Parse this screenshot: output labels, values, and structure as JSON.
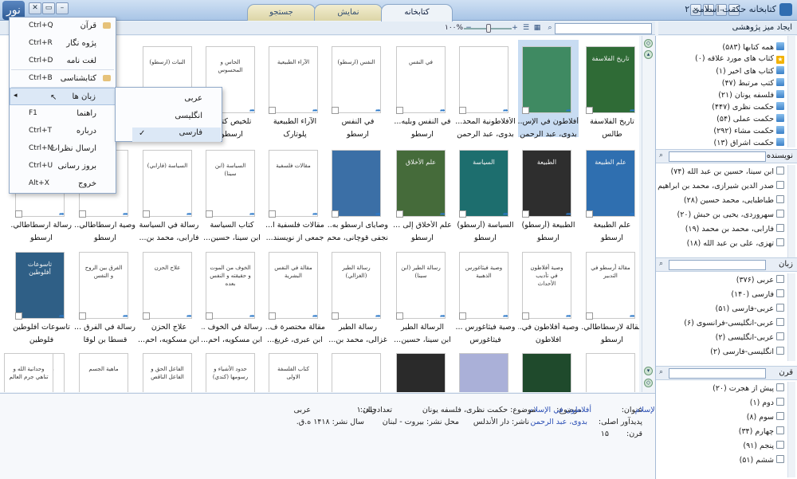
{
  "titlebar": {
    "title": "کتابخانه حکمت اسلامی ۲",
    "logo": "نور"
  },
  "tabs": [
    {
      "label": "جستجو"
    },
    {
      "label": "نمایش"
    },
    {
      "label": "کتابخانه"
    }
  ],
  "toolbar": {
    "zoom": "۱۰۰%",
    "search_placeholder": "",
    "new_table": "ایجاد میز پژوهشی"
  },
  "menu": {
    "items": [
      {
        "label": "قرآن",
        "shortcut": "Ctrl+Q"
      },
      {
        "label": "پژوه نگار",
        "shortcut": "Ctrl+R"
      },
      {
        "label": "لغت نامه",
        "shortcut": "Ctrl+D"
      },
      {
        "label": "کتابشناسی",
        "shortcut": "Ctrl+B"
      },
      {
        "label": "زبان ها",
        "shortcut": ""
      },
      {
        "label": "راهنما",
        "shortcut": "F1"
      },
      {
        "label": "درباره",
        "shortcut": "Ctrl+T"
      },
      {
        "label": "ارسال نظرات",
        "shortcut": "Ctrl+M"
      },
      {
        "label": "بروز رسانی",
        "shortcut": "Ctrl+U"
      },
      {
        "label": "خروج",
        "shortcut": "Alt+X"
      }
    ],
    "languages": [
      {
        "label": "عربی"
      },
      {
        "label": "انگلیسی"
      },
      {
        "label": "فارسی",
        "checked": "✓"
      }
    ]
  },
  "books": [
    {
      "t1": "تاریخ الفلاسفة",
      "t2": "طالس",
      "cover": "تاريخ الفلاسفة",
      "color": "#2f6b36"
    },
    {
      "t1": "أفلاطون في الإس...",
      "t2": "بدوی، عبد الرحمن",
      "cover": "",
      "color": "#3f8a62"
    },
    {
      "t1": "الأفلاطونية المحد...",
      "t2": "بدوی، عبد الرحمن",
      "cover": "",
      "color": "#ffffff"
    },
    {
      "t1": "في النفس وبليه...",
      "t2": "ارسطو",
      "cover": "في النفس",
      "color": "#ffffff"
    },
    {
      "t1": "في النفس",
      "t2": "ارسطو",
      "cover": "النفس (ارسطو)",
      "color": "#ffffff"
    },
    {
      "t1": "الآراء الطبيعية",
      "t2": "پلوتارک",
      "cover": "الآراء الطبيعية",
      "color": "#ffffff"
    },
    {
      "t1": "تلخيص كتا...",
      "t2": "ارسطو",
      "cover": "الحاس و المحسوس",
      "color": "#ffffff"
    },
    {
      "t1": "",
      "t2": "",
      "cover": "النبات (ارسطو)",
      "color": "#ffffff"
    },
    {
      "t1": "علم الطبيعة",
      "t2": "ارسطو",
      "cover": "علم الطبيعة",
      "color": "#2f6fb0"
    },
    {
      "t1": "الطبيعة (أرسطو)",
      "t2": "ارسطو",
      "cover": "الطبيعة",
      "color": "#2e2e2e"
    },
    {
      "t1": "السياسة (أرسطو)",
      "t2": "ارسطو",
      "cover": "السياسة",
      "color": "#1d6e6e"
    },
    {
      "t1": "علم الأخلاق إلى ...",
      "t2": "ارسطو",
      "cover": "علم الأخلاق",
      "color": "#456b3a"
    },
    {
      "t1": "وصايای ارسطو به...",
      "t2": "نجفی قوچانی، محم...",
      "cover": "",
      "color": "#3b6fa6"
    },
    {
      "t1": "مقالات فلسفية ا...",
      "t2": "جمعی از نویسند...",
      "cover": "مقالات فلسفية",
      "color": "#ffffff"
    },
    {
      "t1": "كتاب السياسة",
      "t2": "ابن سینا، حسین...",
      "cover": "السياسة (ابن سينا)",
      "color": "#ffffff"
    },
    {
      "t1": "رسالة في السياسة",
      "t2": "فارابی، محمد بن...",
      "cover": "السياسة (فارابي)",
      "color": "#ffffff"
    },
    {
      "t1": "وصية ارسطاطالي...",
      "t2": "ارسطو",
      "cover": "",
      "color": "#ffffff"
    },
    {
      "t1": "رسالة ارسطاطالي...",
      "t2": "ارسطو",
      "cover": "",
      "color": "#ffffff"
    },
    {
      "t1": "مقالة لارسطاطالي...",
      "t2": "ارسطو",
      "cover": "مقالة أرسطو في التدبير",
      "color": "#ffffff"
    },
    {
      "t1": "وصية أفلاطون في...",
      "t2": "افلاطون",
      "cover": "وصية أفلاطون في تأديب الأحداث",
      "color": "#ffffff"
    },
    {
      "t1": "وصية فيثاغورس ...",
      "t2": "فیثاغورس",
      "cover": "وصية فيثاغورس الذهبية",
      "color": "#ffffff"
    },
    {
      "t1": "الرسالة الطير",
      "t2": "ابن سینا، حسین...",
      "cover": "رسالة الطير (ابن سينا)",
      "color": "#ffffff"
    },
    {
      "t1": "رسالة الطير",
      "t2": "غزالی، محمد بن...",
      "cover": "رسالة الطير (الغزالي)",
      "color": "#ffffff"
    },
    {
      "t1": "مقالة مختصرة ف...",
      "t2": "ابن عبری، غریغ...",
      "cover": "مقالة في النفس البشرية",
      "color": "#ffffff"
    },
    {
      "t1": "رسالة في الخوف ...",
      "t2": "ابن مسکویه، احم...",
      "cover": "الخوف من الموت و حقيقته و النفس بعده",
      "color": "#ffffff"
    },
    {
      "t1": "علاج الحزن",
      "t2": "ابن مسکویه، احم...",
      "cover": "علاج الحزن",
      "color": "#ffffff"
    },
    {
      "t1": "رسالة في الفرق ...",
      "t2": "قسطا بن لوقا",
      "cover": "الفرق بين الروح و النفس",
      "color": "#ffffff"
    },
    {
      "t1": "تاسوعات أفلوطين",
      "t2": "فلوطین",
      "cover": "تاسوعات أفلوطين",
      "color": "#2f5f86"
    },
    {
      "t1": "",
      "t2": "",
      "cover": "",
      "color": "#ffffff"
    },
    {
      "t1": "",
      "t2": "",
      "cover": "",
      "color": "#1f4a2c"
    },
    {
      "t1": "",
      "t2": "",
      "cover": "",
      "color": "#aab0d8"
    },
    {
      "t1": "",
      "t2": "",
      "cover": "",
      "color": "#2a2a2a"
    },
    {
      "t1": "",
      "t2": "",
      "cover": "",
      "color": "#ffffff"
    },
    {
      "t1": "",
      "t2": "",
      "cover": "كتاب الفلسفة الاولى",
      "color": "#ffffff"
    },
    {
      "t1": "",
      "t2": "",
      "cover": "حدود الأشياء و رسومها (كندي)",
      "color": "#ffffff"
    },
    {
      "t1": "",
      "t2": "",
      "cover": "الفاعل الحق و الفاعل الناقص",
      "color": "#ffffff"
    },
    {
      "t1": "",
      "t2": "",
      "cover": "ماهية الجسم",
      "color": "#ffffff"
    },
    {
      "t1": "",
      "t2": "",
      "cover": "ما لا نهاية له",
      "color": "#ffffff"
    },
    {
      "t1": "",
      "t2": "",
      "cover": "وحدانية الله و تناهي جرم العالم",
      "color": "#ffffff"
    }
  ],
  "info": {
    "title_label": "عنوان:",
    "title_value": "أفلاطون في الإسلام",
    "subject_label": "موضوع:",
    "subject_value": "حکمت نظری، فلسفه یونان",
    "lang_label": "زبان:",
    "lang_value": "عربی",
    "author_label": "پدیدآور اصلی:",
    "author_value": "بدوی، عبد الرحمن",
    "publisher_label": "ناشر:",
    "publisher_value": "دار الأندلس",
    "place_label": "محل نشر:",
    "place_value": "بیروت - لبنان",
    "year_label": "سال نشر:",
    "year_value": "۱۴۱۸ ه.ق.",
    "volumes_label": "تعدادجلد:",
    "volumes_value": "۱",
    "century_label": "قرن:",
    "century_value": "۱۵"
  },
  "sidebar": {
    "collections": [
      {
        "label": "همه کتابها (۵۸۳)",
        "icon": "blue"
      },
      {
        "label": "کتاب های مورد علاقه (۰)",
        "icon": "star"
      },
      {
        "label": "کتاب های اخیر (۱)",
        "icon": "blue"
      },
      {
        "label": "کتب مرتبط (۴۷)",
        "icon": "blue"
      },
      {
        "label": "فلسفه یونان (۲۱)",
        "icon": "blue"
      },
      {
        "label": "حکمت نظری (۴۴۷)",
        "icon": "blue"
      },
      {
        "label": "حکمت عملی (۵۴)",
        "icon": "blue"
      },
      {
        "label": "حکمت مشاء (۲۹۲)",
        "icon": "blue"
      },
      {
        "label": "حکمت اشراق (۱۳)",
        "icon": "blue"
      }
    ],
    "author_title": "نویسنده",
    "authors": [
      {
        "label": "ابن سینا، حسین بن عبد الله (۷۴)"
      },
      {
        "label": "صدر الدین شیرازی، محمد بن ابراهیم"
      },
      {
        "label": "طباطبایی، محمد حسین (۲۸)"
      },
      {
        "label": "سهروردی، یحیی بن حبش (۲۰)"
      },
      {
        "label": "فارابی، محمد بن محمد (۱۹)"
      },
      {
        "label": "تهزی، علی بن عبد الله (۱۸)"
      }
    ],
    "language_title": "زبان",
    "languages": [
      {
        "label": "عربی (۳۷۶)"
      },
      {
        "label": "فارسی (۱۴۰)"
      },
      {
        "label": "عربی-فارسی (۵۱)"
      },
      {
        "label": "عربی-انگلیسی-فرانسوی (۶)"
      },
      {
        "label": "عربی-انگلیسی (۲)"
      },
      {
        "label": "انگلیسی-فارسی (۲)"
      }
    ],
    "century_title": "قرن",
    "centuries": [
      {
        "label": "پیش از هجرت (۲۰)"
      },
      {
        "label": "دوم (۱)"
      },
      {
        "label": "سوم (۸)"
      },
      {
        "label": "چهارم (۳۴)"
      },
      {
        "label": "پنجم (۹۱)"
      },
      {
        "label": "ششم (۵۱)"
      }
    ]
  }
}
